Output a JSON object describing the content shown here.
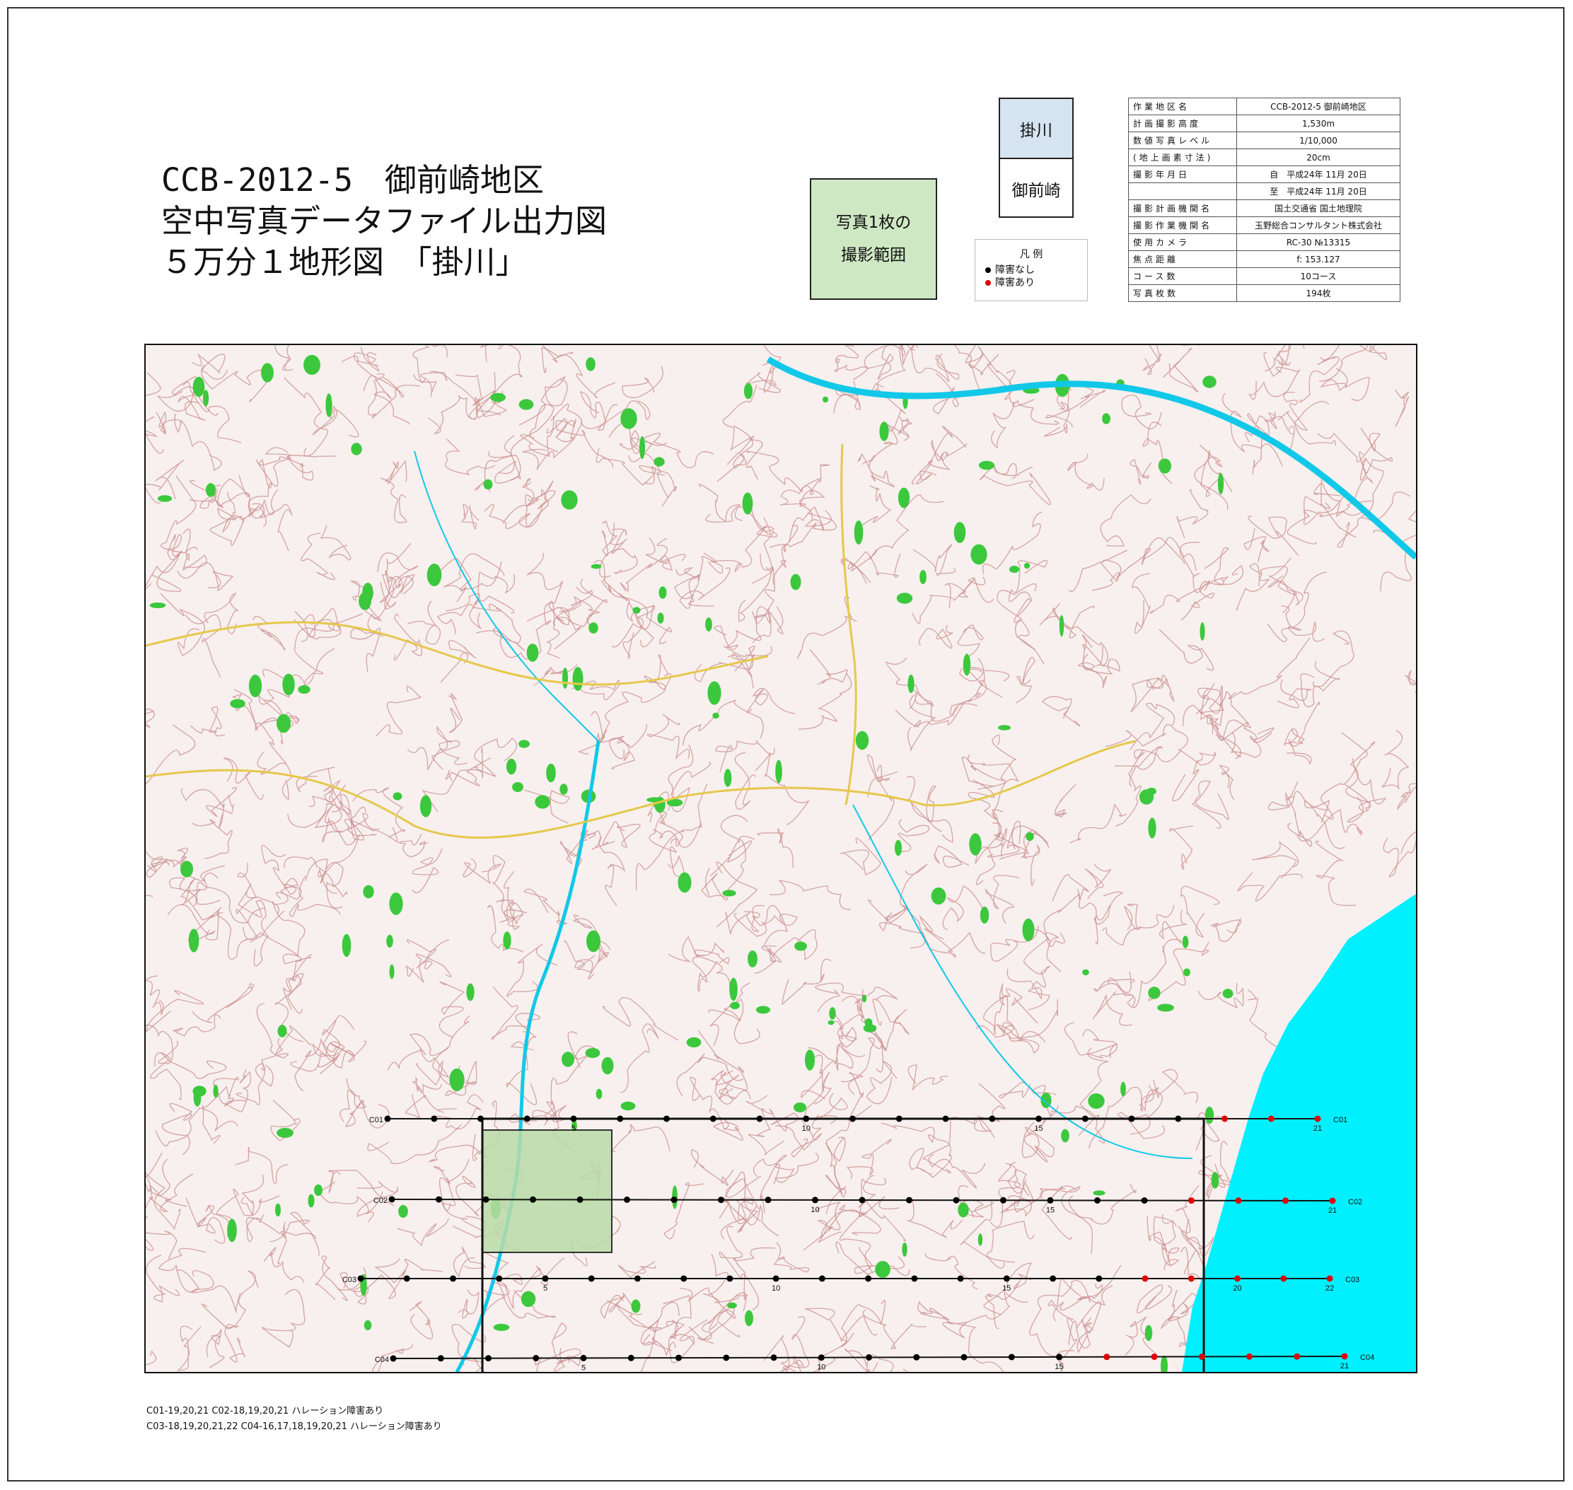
{
  "title": {
    "line1": "CCB-2012-5　御前崎地区",
    "line2": "空中写真データファイル出力図",
    "line3": "５万分１地形図　「掛川」"
  },
  "photo_range": {
    "line1": "写真1枚の",
    "line2": "撮影範囲"
  },
  "sheets": {
    "current": "掛川",
    "other": "御前崎"
  },
  "legend": {
    "title": "凡 例",
    "no_obstruction": "障害なし",
    "obstruction": "障害あり",
    "colors": {
      "ok": "#000000",
      "bad": "#e00000"
    }
  },
  "info_table": [
    {
      "key": "作業地区名",
      "value": "CCB-2012-5 御前崎地区"
    },
    {
      "key": "計画撮影高度",
      "value": "1,530m"
    },
    {
      "key": "数値写真レベル",
      "value": "1/10,000"
    },
    {
      "key": "(地上画素寸法)",
      "value": "20cm"
    },
    {
      "key": "撮影年月日",
      "value": "自　平成24年 11月 20日"
    },
    {
      "key": "",
      "value": "至　平成24年 11月 20日"
    },
    {
      "key": "撮影計画機関名",
      "value": "国土交通省 国土地理院"
    },
    {
      "key": "撮影作業機関名",
      "value": "玉野総合コンサルタント株式会社"
    },
    {
      "key": "使用カメラ",
      "value": "RC-30 №13315"
    },
    {
      "key": "焦点距離",
      "value": "f: 153.127"
    },
    {
      "key": "コース数",
      "value": "10コース"
    },
    {
      "key": "写真枚数",
      "value": "194枚"
    }
  ],
  "map_colors": {
    "land": "#f7f0ee",
    "contour": "#c98b8b",
    "forest": "#3cc83c",
    "sea": "#00f0ff",
    "river": "#12c8e8",
    "road": "#e6c84c",
    "range": "#b9dba8"
  },
  "courses": [
    {
      "name": "C01",
      "count": 21,
      "bad": [
        19,
        20,
        21
      ],
      "labels": {
        "5": "5",
        "10": "10",
        "15": "15",
        "21": "21"
      }
    },
    {
      "name": "C02",
      "count": 21,
      "bad": [
        18,
        19,
        20,
        21
      ],
      "labels": {
        "10": "10",
        "15": "15",
        "21": "21"
      }
    },
    {
      "name": "C03",
      "count": 22,
      "bad": [
        18,
        19,
        20,
        21,
        22
      ],
      "labels": {
        "5": "5",
        "10": "10",
        "15": "15",
        "20": "20",
        "22": "22"
      }
    },
    {
      "name": "C04",
      "count": 21,
      "bad": [
        16,
        17,
        18,
        19,
        20,
        21
      ],
      "labels": {
        "5": "5",
        "10": "10",
        "15": "15",
        "21": "21"
      }
    }
  ],
  "notes": {
    "line1": "C01-19,20,21 C02-18,19,20,21 ハレーション障害あり",
    "line2": "C03-18,19,20,21,22 C04-16,17,18,19,20,21 ハレーション障害あり"
  }
}
